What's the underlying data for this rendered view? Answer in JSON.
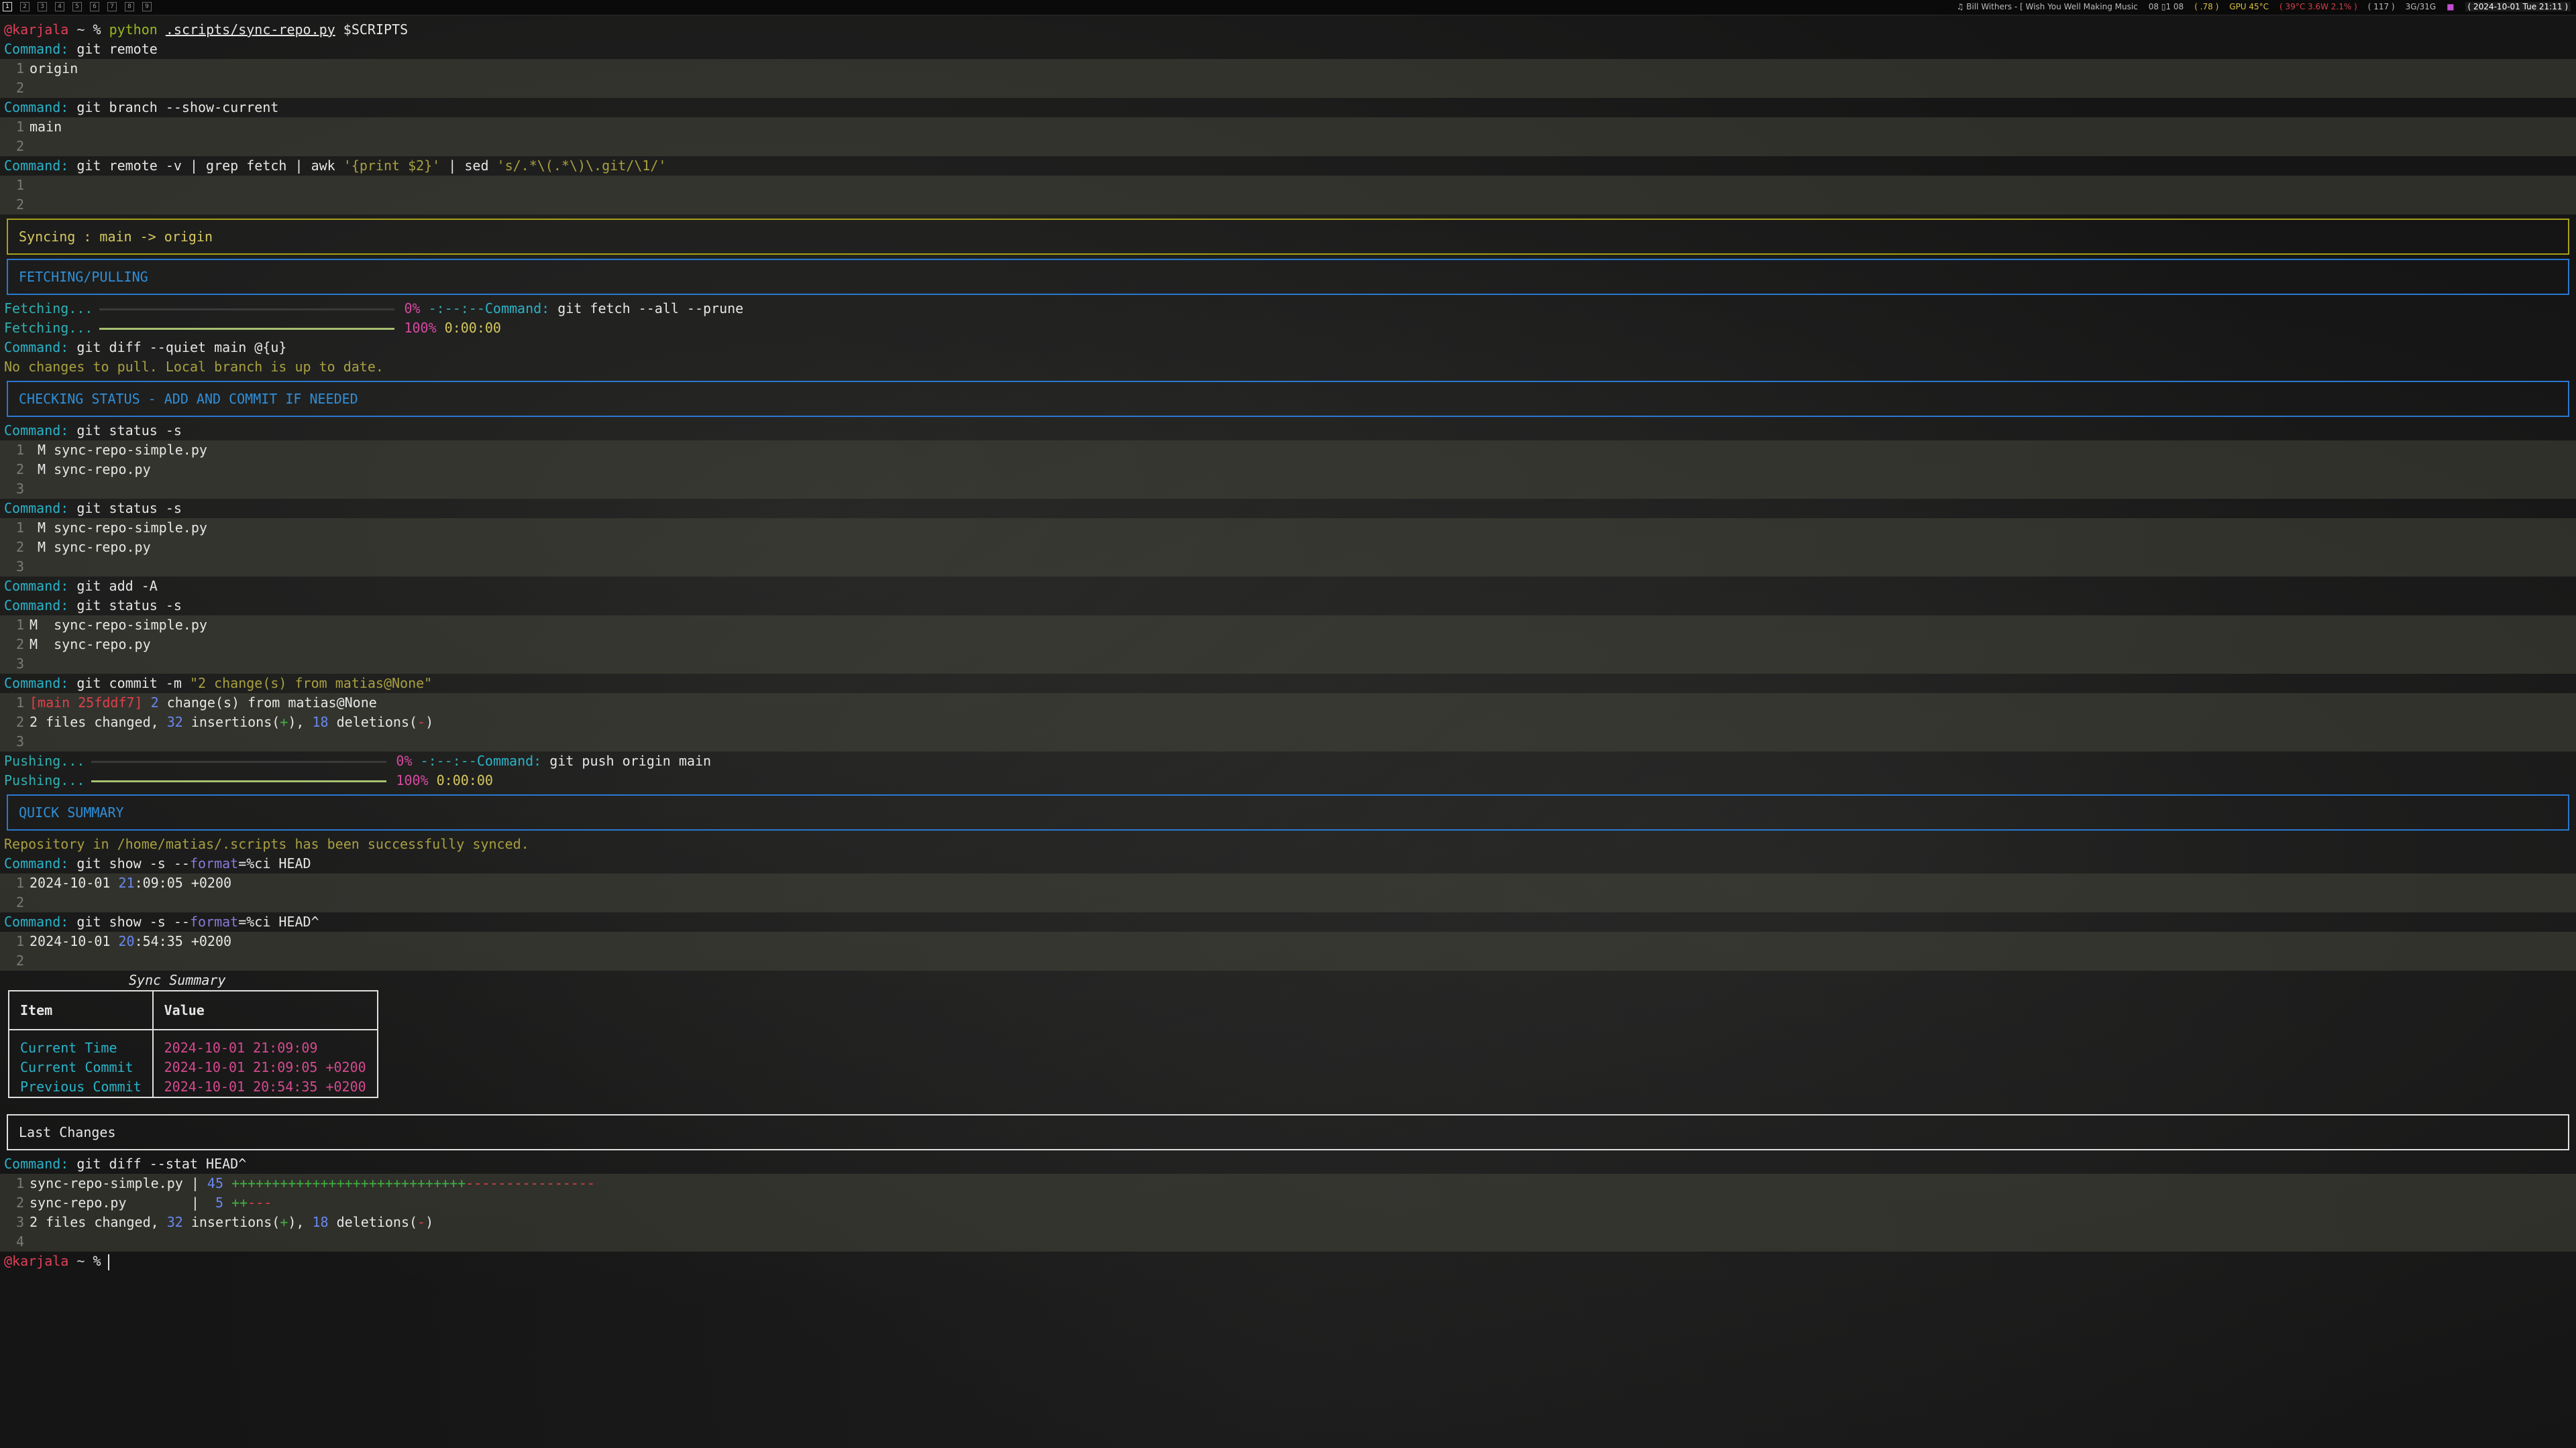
{
  "topbar": {
    "workspaces": [
      "1",
      "2",
      "3",
      "4",
      "5",
      "6",
      "7",
      "8",
      "9"
    ],
    "media": "♫ Bill Withers - [ Wish You Well Making Music",
    "stats": "08 ▯1 08",
    "load": "( .78 )",
    "gpu": "GPU 45°C",
    "cpu": "( 39°C 3.6W 2.1% )",
    "procs": "( 117 )",
    "mem": "3G/31G",
    "clock": "( 2024-10-01 Tue 21:11 )"
  },
  "prompt": {
    "user": "@karjala",
    "tilde": "~",
    "symbol": "%",
    "first_cmd": "python",
    "script_path": ".scripts/sync-repo.py",
    "arg": "$SCRIPTS"
  },
  "labels": {
    "command": "Command:",
    "fetching": "Fetching...",
    "pushing": "Pushing...",
    "pct0": "0%",
    "pct100": "100%",
    "eta_unknown": "-:--:--",
    "eta_zero": "0:00:00"
  },
  "progress": {
    "start_fraction": 0,
    "end_fraction": 1
  },
  "commands": {
    "git_remote": "git remote",
    "git_branch": "git branch --show-current",
    "git_remote_v": "git remote -v | grep fetch | awk",
    "awk_arg": "'{print $2}'",
    "pipe_sed": "| sed",
    "sed_arg": "'s/.*\\(.*\\)\\.git/\\1/'",
    "git_fetch": "git fetch --all --prune",
    "git_diff_quiet": "git diff --quiet main @{u}",
    "git_status": "git status -s",
    "git_add": "git add -A",
    "git_commit": "git commit -m",
    "commit_msg": "\"2 change(s) from matias@None\"",
    "git_push": "git push origin main",
    "git_show_1": "git show -s --",
    "format_kw": "format",
    "git_show_1_rest": "=%ci HEAD",
    "git_show_2_rest": "=%ci HEAD^",
    "git_diff_stat": "git diff --stat HEAD^"
  },
  "outputs": {
    "remote": "origin",
    "branch": "main",
    "status_line1": " M sync-repo-simple.py",
    "status_line2": " M sync-repo.py",
    "staged_line1": "M  sync-repo-simple.py",
    "staged_line2": "M  sync-repo.py",
    "commit_line1_a": "[main 25fddf7]",
    "commit_line1_b": "2",
    "commit_line1_c": "change(s) from matias@None",
    "files_changed_a": "2 files changed,",
    "files_changed_n1": "32",
    "files_changed_b": "insertions(",
    "plus_sign": "+",
    "files_changed_c": "),",
    "files_changed_n2": "18",
    "files_changed_d": "deletions(",
    "minus_sign": "-",
    "files_changed_e": ")",
    "head_date_a": "2024-10-01",
    "head_date_b": "21",
    "head_date_c": ":09:05 +0200",
    "prev_date_a": "2024-10-01",
    "prev_date_b": "20",
    "prev_date_c": ":54:35 +0200",
    "no_changes": "No changes to pull. Local branch is up to date.",
    "repo_synced": "Repository in /home/matias/.scripts has been successfully synced."
  },
  "banners": {
    "syncing": "Syncing : main -> origin",
    "fetching": "FETCHING/PULLING",
    "checking": "CHECKING STATUS - ADD AND COMMIT IF NEEDED",
    "quick_summary": "QUICK SUMMARY",
    "last_changes": "Last Changes"
  },
  "sync_summary": {
    "title": "Sync Summary",
    "headers": [
      "Item",
      "Value"
    ],
    "rows": [
      {
        "item": "Current Time",
        "value": "2024-10-01 21:09:09"
      },
      {
        "item": "Current Commit",
        "value": "2024-10-01 21:09:05 +0200"
      },
      {
        "item": "Previous Commit",
        "value": "2024-10-01 20:54:35 +0200"
      }
    ]
  },
  "diff_stat": {
    "file1": "sync-repo-simple.py",
    "file1_sep": "|",
    "file1_count": "45",
    "file1_plus": "+++++++++++++++++++++++++++++",
    "file1_minus": "----------------",
    "file2": "sync-repo.py",
    "file2_sep": "|",
    "file2_count": "5",
    "file2_plus": "++",
    "file2_minus": "---"
  },
  "colors": {
    "command_keyword": "#2ab3c8",
    "banner_blue": "#2a78d0",
    "banner_yellow": "#a8a018",
    "prompt_user": "#e0405a",
    "value_pink": "#d64a90"
  }
}
